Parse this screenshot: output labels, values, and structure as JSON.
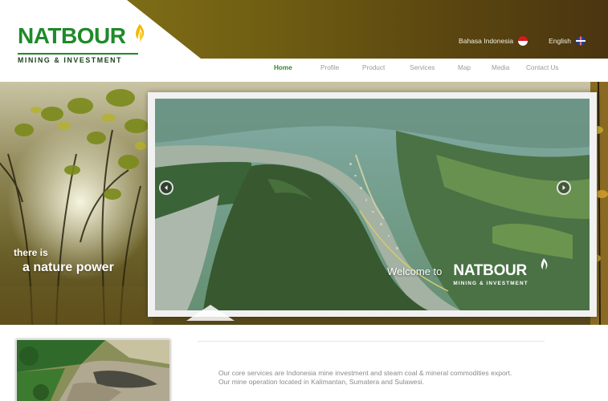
{
  "brand": {
    "name": "NATBOUR",
    "tagline": "MINING & INVESTMENT",
    "colors": {
      "green": "#1e8a2a",
      "header_gold": "#6f5d12"
    }
  },
  "languages": [
    {
      "label": "Bahasa Indonesia",
      "flag": "flag-indonesia-icon"
    },
    {
      "label": "English",
      "flag": "flag-uk-icon"
    }
  ],
  "nav": {
    "active": "Home",
    "items": [
      "Home",
      "Profile",
      "Product",
      "Services",
      "Map",
      "Media",
      "Contact Us"
    ]
  },
  "hero": {
    "slogan_line1": "there is",
    "slogan_line2": "a nature power",
    "slide": {
      "welcome_text": "Welcome to",
      "logo_name": "NATBOUR",
      "logo_tag": "MINING & INVESTMENT",
      "prev_icon": "chevron-left-icon",
      "next_icon": "chevron-right-icon"
    }
  },
  "intro": {
    "line1": "Our core services are Indonesia  mine investment  and steam coal & mineral commodities export.",
    "line2": "Our mine operation located in Kalimantan, Sumatera and Sulawesi."
  }
}
